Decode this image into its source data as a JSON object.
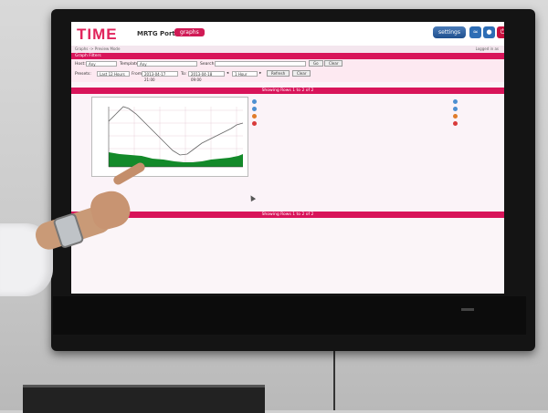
{
  "app": {
    "brand": "TIME",
    "portal_title": "MRTG Portal",
    "active_tab": "graphs",
    "settings_label": "settings",
    "breadcrumb": "Graphs -> Preview Mode",
    "logged_in": "Logged in as"
  },
  "filters": {
    "section_title": "Graph Filters",
    "host_label": "Host:",
    "host_value": "Any",
    "template_label": "Template:",
    "template_value": "Any",
    "search_label": "Search:",
    "go_button": "Go",
    "clear_button": "Clear",
    "presets_label": "Presets:",
    "presets_value": "Last 12 Hours",
    "from_label": "From:",
    "from_value": "2013-04-17 21:00",
    "to_label": "To:",
    "to_value": "2013-04-18 09:00",
    "span_value": "1 Hour",
    "refresh_button": "Refresh",
    "clear2_button": "Clear"
  },
  "listing": {
    "top_bar": "Showing Rows 1 to 2 of 2",
    "bottom_bar": "Showing Rows 1 to 2 of 2"
  },
  "colors": {
    "accent": "#d8145a",
    "brand": "#e1245c"
  }
}
